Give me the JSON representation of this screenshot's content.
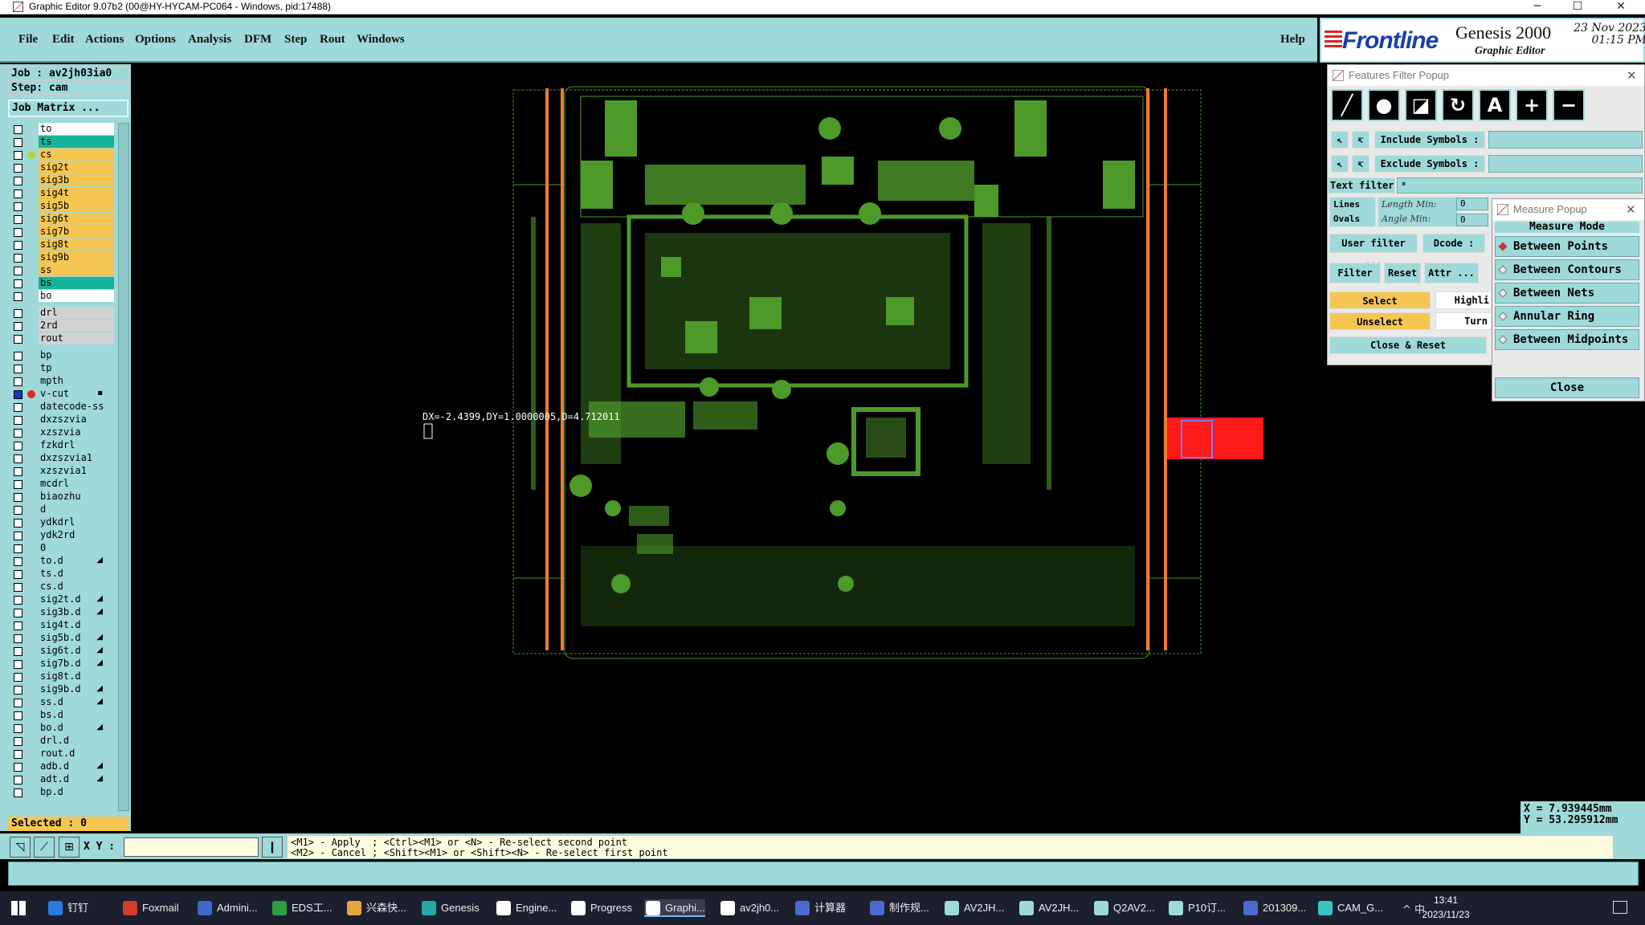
{
  "window": {
    "title": "Graphic Editor 9.07b2 (00@HY-HYCAM-PC064 - Windows, pid:17488)",
    "minimize": "─",
    "maximize": "☐",
    "close": "✕"
  },
  "menu": {
    "items": [
      "File",
      "Edit",
      "Actions",
      "Options",
      "Analysis",
      "DFM",
      "Step",
      "Rout",
      "Windows"
    ],
    "help": "Help"
  },
  "logo": {
    "brand": "Frontline",
    "product": "Genesis 2000",
    "subtitle": "Graphic Editor",
    "date": "23 Nov 2023",
    "time": "01:15 PM"
  },
  "job": {
    "job_label": "Job : av2jh03ia0",
    "step_label": "Step: cam",
    "matrix_button": "Job Matrix ..."
  },
  "layers": [
    {
      "name": "to",
      "fill": "#ffffff"
    },
    {
      "name": "ts",
      "fill": "#16b39a"
    },
    {
      "name": "cs",
      "fill": "#f5c652",
      "dot": "#b5d43d"
    },
    {
      "name": "sig2t",
      "fill": "#f5c652"
    },
    {
      "name": "sig3b",
      "fill": "#f5c652"
    },
    {
      "name": "sig4t",
      "fill": "#f5c652"
    },
    {
      "name": "sig5b",
      "fill": "#f5c652"
    },
    {
      "name": "sig6t",
      "fill": "#f5c652"
    },
    {
      "name": "sig7b",
      "fill": "#f5c652"
    },
    {
      "name": "sig8t",
      "fill": "#f5c652"
    },
    {
      "name": "sig9b",
      "fill": "#f5c652"
    },
    {
      "name": "ss",
      "fill": "#f5c652"
    },
    {
      "name": "bs",
      "fill": "#16b39a"
    },
    {
      "name": "bo",
      "fill": "#ffffff"
    },
    {
      "name": "drl",
      "fill": "#d2d2d2",
      "gap": true
    },
    {
      "name": "2rd",
      "fill": "#d2d2d2"
    },
    {
      "name": "rout",
      "fill": "#d2d2d2"
    },
    {
      "name": "bp",
      "fill": "#9fd9d9",
      "gap": true
    },
    {
      "name": "tp",
      "fill": "#9fd9d9"
    },
    {
      "name": "mpth",
      "fill": "#9fd9d9"
    },
    {
      "name": "v-cut",
      "fill": "#9fd9d9",
      "dot": "#e8231f",
      "cbfill": "#1a36c7",
      "arrow": "▪"
    },
    {
      "name": "datecode-ss",
      "fill": "#9fd9d9"
    },
    {
      "name": "dxzszvia",
      "fill": "#9fd9d9"
    },
    {
      "name": "xzszvia",
      "fill": "#9fd9d9"
    },
    {
      "name": "fzkdrl",
      "fill": "#9fd9d9"
    },
    {
      "name": "dxzszvia1",
      "fill": "#9fd9d9"
    },
    {
      "name": "xzszvia1",
      "fill": "#9fd9d9"
    },
    {
      "name": "mcdrl",
      "fill": "#9fd9d9"
    },
    {
      "name": "biaozhu",
      "fill": "#9fd9d9"
    },
    {
      "name": "d",
      "fill": "#9fd9d9"
    },
    {
      "name": "ydkdrl",
      "fill": "#9fd9d9"
    },
    {
      "name": "ydk2rd",
      "fill": "#9fd9d9"
    },
    {
      "name": "0",
      "fill": "#9fd9d9"
    },
    {
      "name": "to.d",
      "fill": "#9fd9d9",
      "arrow": "◢"
    },
    {
      "name": "ts.d",
      "fill": "#9fd9d9"
    },
    {
      "name": "cs.d",
      "fill": "#9fd9d9"
    },
    {
      "name": "sig2t.d",
      "fill": "#9fd9d9",
      "arrow": "◢"
    },
    {
      "name": "sig3b.d",
      "fill": "#9fd9d9",
      "arrow": "◢"
    },
    {
      "name": "sig4t.d",
      "fill": "#9fd9d9"
    },
    {
      "name": "sig5b.d",
      "fill": "#9fd9d9",
      "arrow": "◢"
    },
    {
      "name": "sig6t.d",
      "fill": "#9fd9d9",
      "arrow": "◢"
    },
    {
      "name": "sig7b.d",
      "fill": "#9fd9d9",
      "arrow": "◢"
    },
    {
      "name": "sig8t.d",
      "fill": "#9fd9d9"
    },
    {
      "name": "sig9b.d",
      "fill": "#9fd9d9",
      "arrow": "◢"
    },
    {
      "name": "ss.d",
      "fill": "#9fd9d9",
      "arrow": "◢"
    },
    {
      "name": "bs.d",
      "fill": "#9fd9d9"
    },
    {
      "name": "bo.d",
      "fill": "#9fd9d9",
      "arrow": "◢"
    },
    {
      "name": "drl.d",
      "fill": "#9fd9d9"
    },
    {
      "name": "rout.d",
      "fill": "#9fd9d9"
    },
    {
      "name": "adb.d",
      "fill": "#9fd9d9",
      "arrow": "◢"
    },
    {
      "name": "adt.d",
      "fill": "#9fd9d9",
      "arrow": "◢"
    },
    {
      "name": "bp.d",
      "fill": "#9fd9d9"
    }
  ],
  "selected": "Selected : 0",
  "measure_readout": "DX=-2.4399,DY=1.0000005,D=4.712011",
  "ffp": {
    "title": "Features Filter Popup",
    "close": "✕",
    "include_symbols": "Include Symbols :",
    "exclude_symbols": "Exclude Symbols :",
    "text_filter": "Text filter",
    "text_filter_value": "*",
    "lines": "Lines",
    "ovals": "Ovals",
    "length": "Length",
    "angle": "Angle",
    "min": "Min:",
    "min_value": "0",
    "user_filter": "User filter ...",
    "dcode": "Dcode :",
    "filter": "Filter",
    "reset": "Reset",
    "attr": "Attr ...",
    "select": "Select",
    "highlight": "Highli",
    "unselect": "Unselect",
    "turn": "Turn",
    "close_reset": "Close & Reset"
  },
  "mp": {
    "title": "Measure Popup",
    "close": "✕",
    "mode_label": "Measure Mode",
    "modes": [
      "Between Points",
      "Between Contours",
      "Between Nets",
      "Annular Ring",
      "Between Midpoints"
    ],
    "close_button": "Close"
  },
  "coords": {
    "x": "X = 7.939445mm",
    "y": "Y = 53.295912mm"
  },
  "bottom": {
    "xy_label": "X Y :",
    "hint_line1": "<M1> - Apply  ; <Ctrl><M1> or <N> - Re-select second point",
    "hint_line2": "<M2> - Cancel ; <Shift><M1> or <Shift><N> - Re-select first point"
  },
  "taskbar": {
    "apps": [
      {
        "label": "钉钉",
        "color": "#2a7ae6"
      },
      {
        "label": "Foxmail",
        "color": "#d43c2c"
      },
      {
        "label": "Admini...",
        "color": "#3f68c9"
      },
      {
        "label": "EDS工...",
        "color": "#2f9e44"
      },
      {
        "label": "兴森快...",
        "color": "#e7a63a"
      },
      {
        "label": "Genesis",
        "color": "#2aa6a6"
      },
      {
        "label": "Engine...",
        "color": "#ffffff"
      },
      {
        "label": "Progress",
        "color": "#ffffff"
      },
      {
        "label": "Graphi...",
        "color": "#ffffff",
        "active": true
      },
      {
        "label": "av2jh0...",
        "color": "#ffffff"
      },
      {
        "label": "计算器",
        "color": "#4c6bd1"
      },
      {
        "label": "制作规...",
        "color": "#4c6bd1"
      },
      {
        "label": "AV2JH...",
        "color": "#9fd9d9"
      },
      {
        "label": "AV2JH...",
        "color": "#9fd9d9"
      },
      {
        "label": "Q2AV2...",
        "color": "#9fd9d9"
      },
      {
        "label": "P10订...",
        "color": "#9fd9d9"
      },
      {
        "label": "201309...",
        "color": "#4c6bd1"
      },
      {
        "label": "CAM_G...",
        "color": "#3ac4c4"
      }
    ],
    "tray": "^  中",
    "time": "13:41",
    "date": "2023/11/23"
  }
}
